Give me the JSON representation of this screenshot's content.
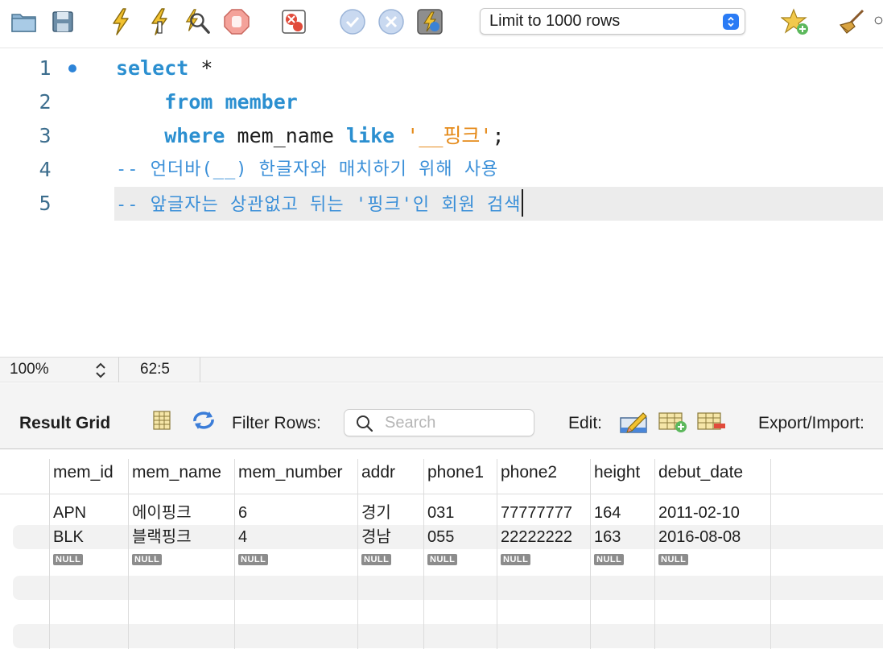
{
  "toolbar": {
    "limit_select": "Limit to 1000 rows",
    "icons": [
      "folder-open-icon",
      "save-icon",
      "execute-icon",
      "execute-current-icon",
      "explain-icon",
      "stop-icon",
      "toggle-continue-on-error-icon",
      "commit-icon",
      "rollback-icon",
      "autocommit-icon",
      "add-snippet-icon",
      "beautify-icon"
    ]
  },
  "editor": {
    "lines": [
      {
        "no": "1"
      },
      {
        "no": "2"
      },
      {
        "no": "3"
      },
      {
        "no": "4"
      },
      {
        "no": "5"
      }
    ],
    "l1_kw": "select",
    "l1_rest": " *",
    "l2_indent": "    ",
    "l2_kw": "from",
    "l2_rest": " member",
    "l3_indent": "    ",
    "l3_kw1": "where",
    "l3_mid": " mem_name ",
    "l3_kw2": "like",
    "l3_str": " '__핑크'",
    "l3_end": ";",
    "l4_comment": "-- 언더바(__) 한글자와 매치하기 위해 사용",
    "l5_comment": "-- 앞글자는 상관없고 뒤는 '핑크'인 회원 검색"
  },
  "status": {
    "zoom": "100%",
    "cursor": "62:5"
  },
  "result": {
    "title": "Result Grid",
    "filter_label": "Filter Rows:",
    "search_placeholder": "Search",
    "edit_label": "Edit:",
    "export_label": "Export/Import:",
    "columns": [
      "mem_id",
      "mem_name",
      "mem_number",
      "addr",
      "phone1",
      "phone2",
      "height",
      "debut_date"
    ],
    "rows": [
      [
        "APN",
        "에이핑크",
        "6",
        "경기",
        "031",
        "77777777",
        "164",
        "2011-02-10"
      ],
      [
        "BLK",
        "블랙핑크",
        "4",
        "경남",
        "055",
        "22222222",
        "163",
        "2016-08-08"
      ]
    ],
    "null_label": "NULL"
  },
  "colors": {
    "keyword": "#2b8fd0",
    "string": "#e58a19",
    "comment": "#3a8fd8",
    "line_number": "#3d6e8e",
    "accent": "#2a7bf5"
  }
}
